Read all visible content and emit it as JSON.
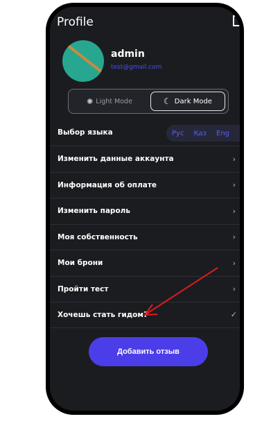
{
  "header": {
    "title": "Profile",
    "logout_icon": "logout-icon"
  },
  "user": {
    "name": "admin",
    "email": "test@gmail.com",
    "avatar_color": "#27a78f"
  },
  "theme": {
    "light_label": "Light Mode",
    "dark_label": "Dark Mode",
    "selected": "Dark Mode"
  },
  "language": {
    "label": "Выбор языка",
    "options": [
      "Рус",
      "Қаз",
      "Eng"
    ],
    "accent": "#5b5ff7"
  },
  "menu": {
    "items": [
      {
        "label": "Изменить данные аккаунта",
        "icon": "chevron-right-icon"
      },
      {
        "label": "Информация об оплате",
        "icon": "chevron-right-icon"
      },
      {
        "label": "Изменить пароль",
        "icon": "chevron-right-icon"
      },
      {
        "label": "Моя собственность",
        "icon": "chevron-right-icon"
      },
      {
        "label": "Мои брони",
        "icon": "chevron-right-icon"
      },
      {
        "label": "Пройти тест",
        "icon": "chevron-right-icon"
      },
      {
        "label": "Хочешь стать гидом?",
        "icon": "check-icon"
      }
    ]
  },
  "review_button": {
    "label": "Добавить отзыв",
    "color": "#4b3ee8"
  },
  "annotation": {
    "arrow_color": "#e01b1b"
  }
}
